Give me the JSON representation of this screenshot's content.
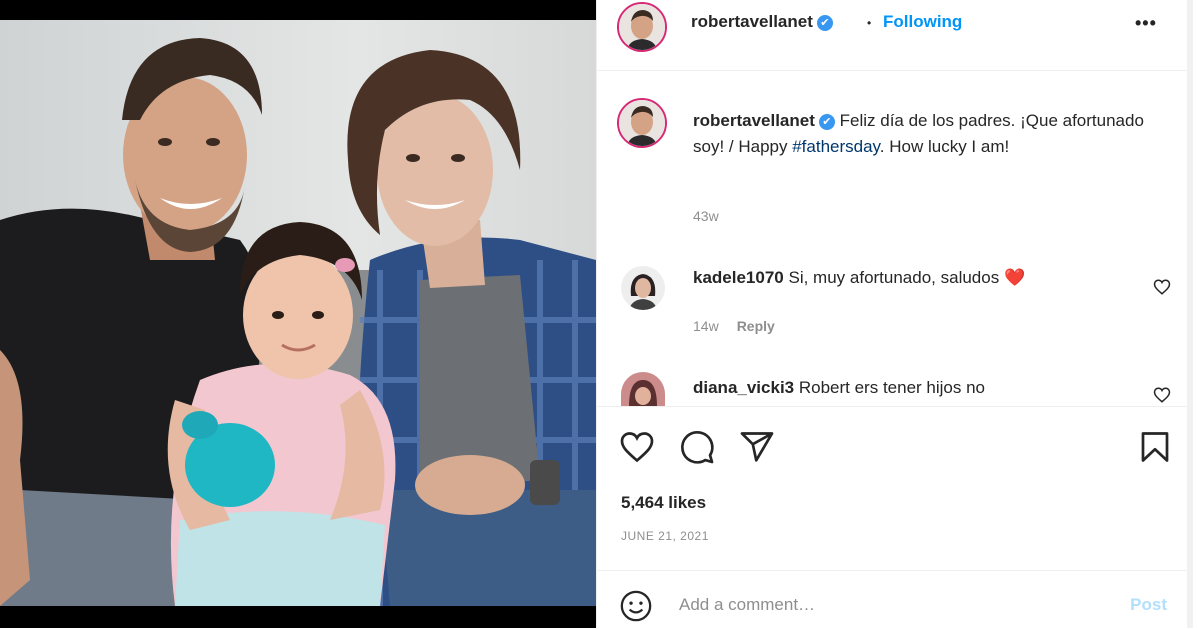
{
  "post": {
    "author": "robertavellanet",
    "verified_mark": "✔",
    "follow_separator": "•",
    "follow_status": "Following",
    "more_options": "•••"
  },
  "caption": {
    "author": "robertavellanet",
    "text_before": "Feliz día de los padres. ¡Que afortunado soy! / Happy ",
    "hashtag": "#fathersday",
    "text_after": ". How lucky I am!",
    "age": "43w"
  },
  "comments": [
    {
      "user": "kadele1070",
      "text": "Si, muy afortunado, saludos",
      "emoji": "❤️",
      "age": "14w",
      "reply_label": "Reply"
    },
    {
      "user": "diana_vicki3",
      "text": "Robert ers tener hijos no"
    }
  ],
  "engagement": {
    "likes": "5,464 likes",
    "date": "JUNE 21, 2021"
  },
  "comment_box": {
    "placeholder": "Add a comment…",
    "post_label": "Post"
  },
  "icons": {
    "like": "heart-icon",
    "comment": "speech-bubble-icon",
    "share": "paper-plane-icon",
    "save": "bookmark-icon",
    "emoji": "smiley-icon"
  },
  "colors": {
    "accent": "#0095f6",
    "verified": "#3897f0",
    "story_ring": "#d62976",
    "heart": "#ed4956"
  }
}
